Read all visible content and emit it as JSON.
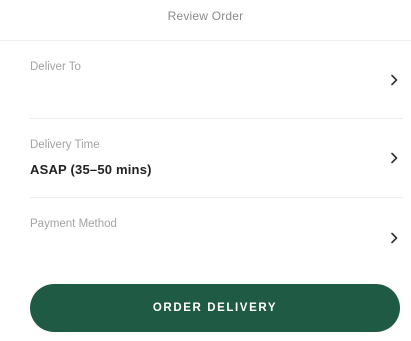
{
  "header": {
    "title": "Review Order"
  },
  "rows": {
    "deliver_to": {
      "label": "Deliver To",
      "value": ""
    },
    "delivery_time": {
      "label": "Delivery Time",
      "value": "ASAP (35–50 mins)"
    },
    "payment_method": {
      "label": "Payment Method",
      "value": ""
    }
  },
  "icons": {
    "row_chevron": "chevron-right-icon"
  },
  "cta": {
    "label": "ORDER DELIVERY"
  },
  "colors": {
    "accent": "#1f5a44",
    "label_gray": "#a3a3a3",
    "divider": "#eeeeee"
  }
}
